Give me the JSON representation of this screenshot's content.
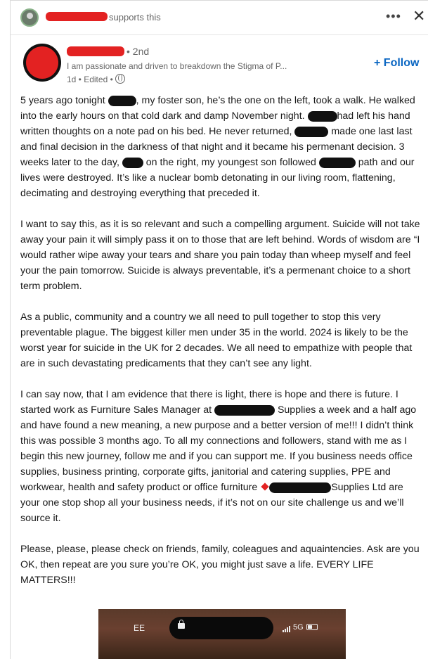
{
  "social": {
    "supports_text": "supports this",
    "more_label": "•••",
    "close_label": "✕"
  },
  "author": {
    "degree": "• 2nd",
    "headline": "I am passionate and driven to breakdown the Stigma of P...",
    "meta": "1d • Edited •",
    "follow_label": "+ Follow"
  },
  "post": {
    "p1": {
      "s1": "5 years ago tonight ",
      "s2": ", my foster son, he’s the one on the left, took a walk. He walked into the early hours on that cold dark and damp November night. ",
      "s3": "had left his hand written thoughts on a note pad on his bed. He never returned, ",
      "s4": " made one last last and final decision in the darkness of that night and it became his permenant decision. 3 weeks later to the day, ",
      "s5": " on the right, my youngest son followed ",
      "s6": " path and our lives were destroyed. It’s like a nuclear bomb detonating in our living room, flattening, decimating and destroying everything that preceded it."
    },
    "p2": "I want to say this, as it is so relevant and such a compelling argument. Suicide will not take away your pain it will simply pass it on to those that are left behind. Words of wisdom are “I would rather wipe away your tears and share you pain today than wheep myself and feel your the pain tomorrow. Suicide is always preventable, it’s a permenant choice to a short term problem.",
    "p3": "As a public, community and a country we all need to pull together to stop this very preventable plague. The biggest killer men under 35 in the world. 2024 is likely to be the worst year for suicide in the UK for 2 decades. We all need to empathize with people that are in such devastating predicaments that they can’t see any light.",
    "p4": {
      "s1": "I can say now, that I am evidence that there is light, there is hope and there is future. I started work as Furniture Sales Manager at ",
      "s2": " Supplies a week and a half ago and have found a new meaning, a new purpose and a better version of me!!! I didn’t think this was possible 3 months ago. To all my connections and followers, stand with me as I begin this new journey, follow me and if you can support me. If you business needs office supplies, business printing, corporate gifts, janitorial and catering supplies, PPE and workwear, health and safety product or office furniture ",
      "s3": "Supplies Ltd are your one stop shop all your business needs, if it’s not on our site challenge us and we’ll source it."
    },
    "p5": "Please, please, please check on friends, family, coleagues and aquaintencies. Ask are you OK, then repeat are you sure you’re OK, you might just save a life. EVERY LIFE MATTERS!!!"
  },
  "media": {
    "carrier": "EE",
    "network": "5G"
  }
}
